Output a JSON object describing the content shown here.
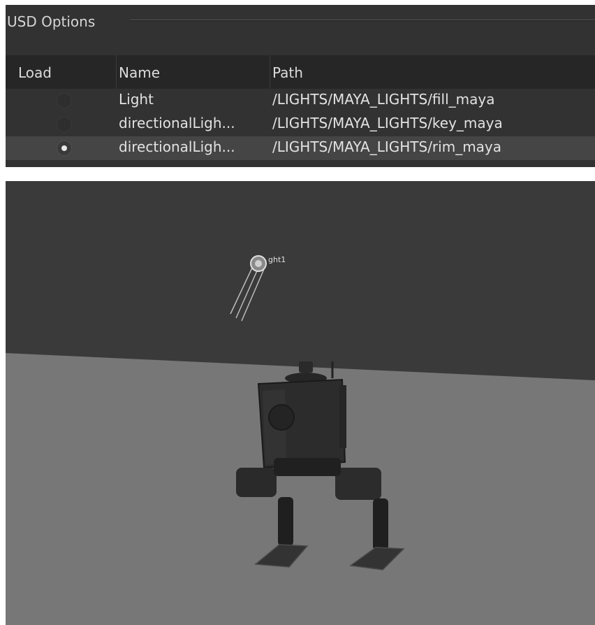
{
  "usd_options": {
    "title": "USD Options",
    "columns": {
      "load": "Load",
      "name": "Name",
      "path": "Path"
    },
    "rows": [
      {
        "loaded": false,
        "name": "Light",
        "path": "/LIGHTS/MAYA_LIGHTS/fill_maya"
      },
      {
        "loaded": false,
        "name": "directionalLigh...",
        "path": "/LIGHTS/MAYA_LIGHTS/key_maya"
      },
      {
        "loaded": true,
        "name": "directionalLigh...",
        "path": "/LIGHTS/MAYA_LIGHTS/rim_maya"
      }
    ]
  },
  "viewport": {
    "light_label": "ght1",
    "sky_color": "#3a3a3a",
    "floor_color": "#777777"
  }
}
